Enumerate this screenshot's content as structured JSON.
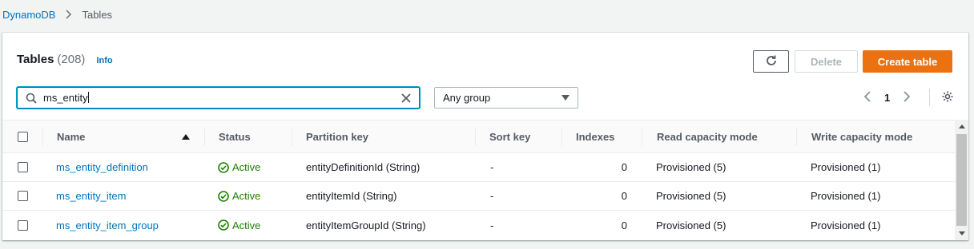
{
  "breadcrumb": {
    "root": "DynamoDB",
    "current": "Tables"
  },
  "header": {
    "title": "Tables",
    "count": "(208)",
    "info_link": "Info"
  },
  "actions": {
    "refresh_icon": "refresh-icon",
    "delete_label": "Delete",
    "create_label": "Create table"
  },
  "search": {
    "value": "ms_entity",
    "placeholder": ""
  },
  "group_filter": {
    "selected": "Any group"
  },
  "pagination": {
    "current_page": "1"
  },
  "table": {
    "columns": [
      "Name",
      "Status",
      "Partition key",
      "Sort key",
      "Indexes",
      "Read capacity mode",
      "Write capacity mode"
    ],
    "sort_column": "Name",
    "sort_direction": "ascending",
    "rows": [
      {
        "name": "ms_entity_definition",
        "status": "Active",
        "partition_key": "entityDefinitionId (String)",
        "sort_key": "-",
        "indexes": "0",
        "read_capacity": "Provisioned (5)",
        "write_capacity": "Provisioned (1)"
      },
      {
        "name": "ms_entity_item",
        "status": "Active",
        "partition_key": "entityItemId (String)",
        "sort_key": "-",
        "indexes": "0",
        "read_capacity": "Provisioned (5)",
        "write_capacity": "Provisioned (1)"
      },
      {
        "name": "ms_entity_item_group",
        "status": "Active",
        "partition_key": "entityItemGroupId (String)",
        "sort_key": "-",
        "indexes": "0",
        "read_capacity": "Provisioned (5)",
        "write_capacity": "Provisioned (1)"
      }
    ]
  },
  "colors": {
    "link": "#0073bb",
    "primary_button": "#ec7211",
    "status_active": "#1d8102"
  }
}
